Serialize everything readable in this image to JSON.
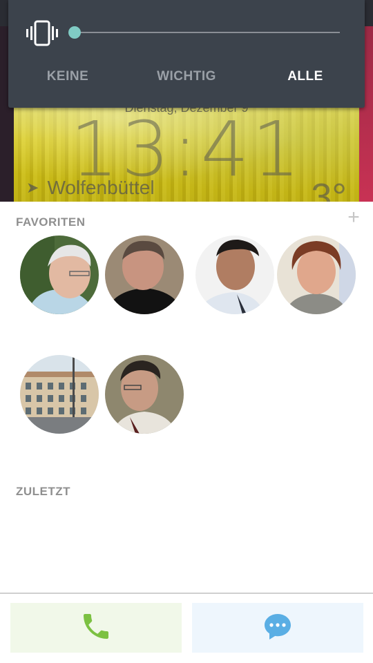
{
  "lockscreen": {
    "date": "Dienstag, Dezember 9",
    "time": "13:41",
    "location": "Wolfenbüttel",
    "temperature": "3°"
  },
  "volume_panel": {
    "icon": "vibrate-icon",
    "slider_level": 0,
    "accent_color": "#80cbc4",
    "modes": [
      {
        "label": "KEINE",
        "active": false
      },
      {
        "label": "WICHTIG",
        "active": false
      },
      {
        "label": "ALLE",
        "active": true
      }
    ]
  },
  "favorites": {
    "title": "FAVORITEN",
    "add_icon": "plus-icon",
    "contacts_count_visible": 6
  },
  "recent": {
    "title": "ZULETZT"
  },
  "actions": {
    "call_icon": "phone-icon",
    "call_color": "#7cc142",
    "message_icon": "chat-bubble-icon",
    "message_color": "#5aaee4"
  }
}
